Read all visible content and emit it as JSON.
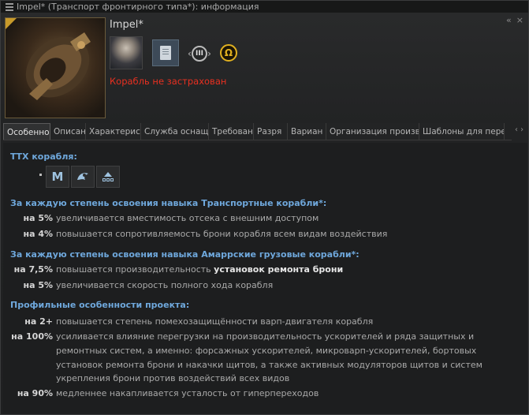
{
  "window": {
    "title": "Impel* (Транспорт фронтирного типа*): информация",
    "controls": [
      "«",
      "×"
    ]
  },
  "header": {
    "ship_name": "Impel*",
    "insurance": "Корабль не застрахован",
    "rank_label": "III",
    "omega_label": "Ω"
  },
  "tabs": [
    "Особенно",
    "Описан",
    "Характерис",
    "Служба оснащ",
    "Требован",
    "Разря",
    "Вариан",
    "Организация произв",
    "Шаблоны для перет"
  ],
  "tabs_arrows": "‹ ›",
  "traits": {
    "ttx_title": "ТТХ корабля:",
    "ttx_icons": [
      "М",
      "drone-icon",
      "grid-icon"
    ],
    "ttx_dot": "·",
    "section1": {
      "title": "За каждую степень освоения навыка Транспортные корабли*:",
      "rows": [
        {
          "amount": "на 5%",
          "text": "увеличивается вместимость отсека с внешним доступом"
        },
        {
          "amount": "на 4%",
          "text": "повышается сопротивляемость брони корабля всем видам воздействия"
        }
      ]
    },
    "section2": {
      "title": "За каждую степень освоения навыка Амаррские грузовые корабли*:",
      "rows": [
        {
          "amount": "на 7,5%",
          "text_pre": "повышается производительность ",
          "text_hl": "установок ремонта брони"
        },
        {
          "amount": "на 5%",
          "text": "увеличивается скорость полного хода корабля"
        }
      ]
    },
    "section3": {
      "title": "Профильные особенности проекта:",
      "rows": [
        {
          "amount": "на 2+",
          "text": "повышается степень помехозащищённости варп-двигателя корабля"
        },
        {
          "amount": "на 100%",
          "lines": [
            "усиливается влияние перегрузки на производительность ускорителей и ряда защитных и",
            "ремонтных систем, а именно: форсажных ускорителей, микроварп-ускорителей, бортовых",
            "установок ремонта брони и накачки щитов, а также активных модуляторов щитов и систем",
            "укрепления брони против воздействий всех видов"
          ]
        },
        {
          "amount": "на 90%",
          "text": "медленнее накапливается усталость от гиперпереходов"
        }
      ]
    }
  }
}
